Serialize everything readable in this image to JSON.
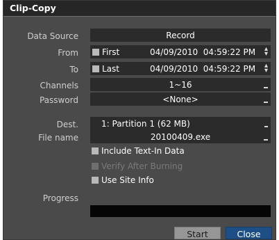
{
  "title": "Clip-Copy",
  "labels": {
    "data_source": "Data Source",
    "from": "From",
    "to": "To",
    "channels": "Channels",
    "password": "Password",
    "dest": "Dest.",
    "file_name": "File name",
    "progress": "Progress"
  },
  "values": {
    "data_source": "Record",
    "from_mode": "First",
    "from_datetime": "04/09/2010  04:59:22 PM",
    "to_mode": "Last",
    "to_datetime": "04/09/2010  04:59:22 PM",
    "channels": "1~16",
    "password": "<None>",
    "dest": "1: Partition 1 (62 MB)",
    "file_name": "20100409.exe"
  },
  "checkboxes": {
    "include_text_in": "Include Text-In Data",
    "verify_after_burning": "Verify After Burning",
    "use_site_info": "Use Site Info"
  },
  "progress_value": 0,
  "buttons": {
    "start": "Start",
    "close": "Close"
  },
  "colors": {
    "accent": "#1d4f86",
    "dialog_bg": "#4a4a4a",
    "field_bg": "#2b2b2b"
  }
}
